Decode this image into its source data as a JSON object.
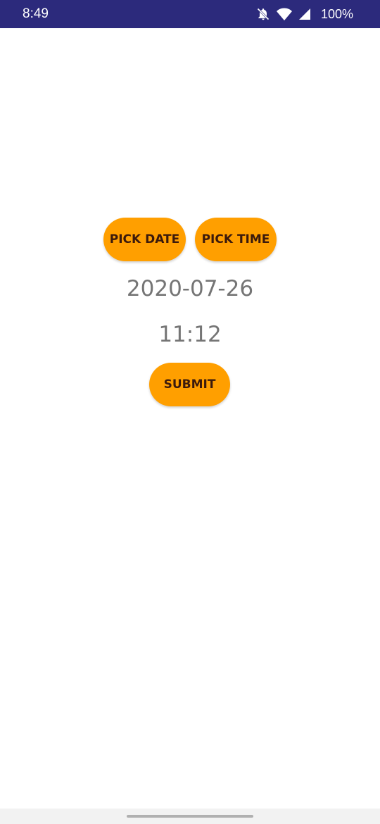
{
  "status_bar": {
    "time": "8:49",
    "battery": "100%",
    "background_color": "#2c2a7c",
    "icons": [
      "notifications-off-icon",
      "wifi-icon",
      "cell-signal-icon"
    ]
  },
  "buttons": {
    "pick_date": "PICK DATE",
    "pick_time": "PICK TIME",
    "submit": "SUBMIT",
    "color": "#ff9f00",
    "text_color": "#3b1a0c"
  },
  "values": {
    "date": "2020-07-26",
    "time": "11:12"
  }
}
